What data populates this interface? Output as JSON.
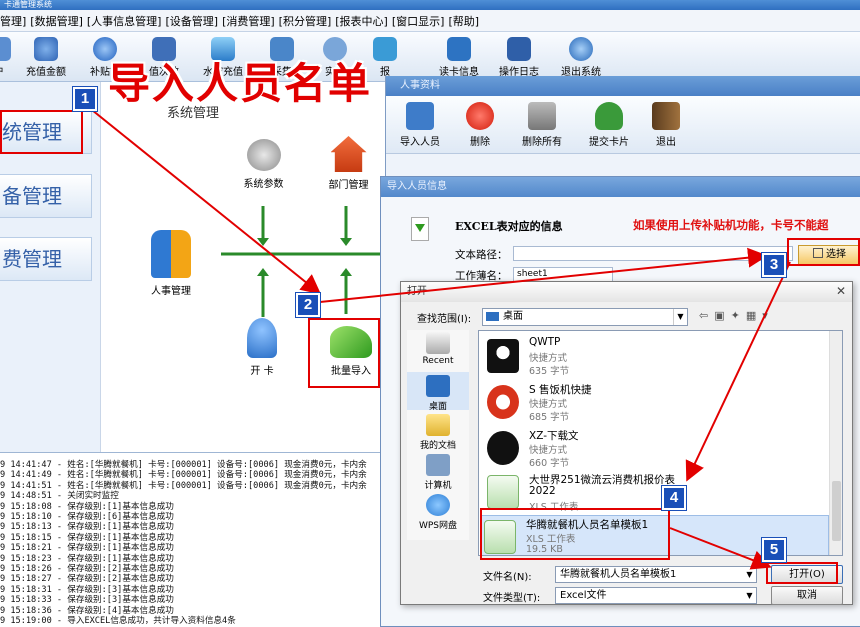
{
  "app": {
    "title": "卡通管理系统"
  },
  "menu": [
    "管理]",
    "[数据管理]",
    "[人事信息管理]",
    "[设备管理]",
    "[消费管理]",
    "[积分管理]",
    "[报表中心]",
    "[窗口显示]",
    "[帮助]"
  ],
  "toolbar": {
    "items": [
      {
        "label": "户",
        "icon": "user-icon"
      },
      {
        "label": "充值金额",
        "icon": "recharge-icon"
      },
      {
        "label": "补贴管",
        "icon": "subsidy-icon"
      },
      {
        "label": "值次数",
        "icon": "count-icon"
      },
      {
        "label": "水控充值",
        "icon": "water-icon"
      },
      {
        "label": "采集",
        "icon": "collect-icon"
      },
      {
        "label": "实时",
        "icon": "realtime-icon"
      },
      {
        "label": "报",
        "icon": "report-icon"
      },
      {
        "label": "读卡信息",
        "icon": "card-read-icon"
      },
      {
        "label": "操作日志",
        "icon": "log-icon"
      },
      {
        "label": "退出系统",
        "icon": "exit-icon"
      }
    ]
  },
  "sidebar": {
    "items": [
      "统管理",
      "备管理",
      "费管理"
    ]
  },
  "content": {
    "section_title": "系统管理",
    "nodes": {
      "system_params": "系统参数",
      "department": "部门管理",
      "personnel": "人事管理",
      "issue_card": "开 卡",
      "batch_import": "批量导入"
    }
  },
  "log": [
    "9 14:41:47 - 姓名:[华腾就餐机] 卡号:[000001] 设备号:[0006] 现金消费0元，卡内余",
    "9 14:41:49 - 姓名:[华腾就餐机] 卡号:[000001] 设备号:[0006] 现金消费0元，卡内余",
    "9 14:41:51 - 姓名:[华腾就餐机] 卡号:[000001] 设备号:[0006] 现金消费0元，卡内余",
    "9 14:48:51 - 关闭实时监控",
    "9 15:18:08 - 保存级别:[1]基本信息成功",
    "9 15:18:10 - 保存级别:[6]基本信息成功",
    "9 15:18:13 - 保存级别:[1]基本信息成功",
    "9 15:18:15 - 保存级别:[1]基本信息成功",
    "9 15:18:21 - 保存级别:[1]基本信息成功",
    "9 15:18:23 - 保存级别:[1]基本信息成功",
    "9 15:18:26 - 保存级别:[2]基本信息成功",
    "9 15:18:27 - 保存级别:[2]基本信息成功",
    "9 15:18:31 - 保存级别:[3]基本信息成功",
    "9 15:18:33 - 保存级别:[3]基本信息成功",
    "9 15:18:36 - 保存级别:[4]基本信息成功",
    "9 15:19:00 - 导入EXCEL信息成功，共计导入资料信息4条"
  ],
  "import_window": {
    "title": "人事资料",
    "buttons": [
      "导入人员",
      "删除",
      "删除所有",
      "提交卡片",
      "退出"
    ]
  },
  "excel_window": {
    "title": "导入人员信息",
    "heading": "EXCEL表对应的信息",
    "warning": "如果使用上传补贴机功能，卡号不能超",
    "path_label": "文本路径：",
    "sheet_label": "工作薄名：",
    "sheet_value": "sheet1",
    "select_button": "选择"
  },
  "open_dialog": {
    "title": "打开",
    "lookin_label": "查找范围(I):",
    "lookin_value": "桌面",
    "places": [
      "Recent",
      "桌面",
      "我的文档",
      "计算机",
      "WPS网盘"
    ],
    "files": [
      {
        "name": "QWTP",
        "type": "快捷方式",
        "size": "635 字节"
      },
      {
        "name": "S 售饭机快捷",
        "type": "快捷方式",
        "size": "685 字节"
      },
      {
        "name": "XZ-下载文",
        "type": "快捷方式",
        "size": "660 字节"
      },
      {
        "name": "大世界251微流云消费机报价表",
        "name2": "2022",
        "type": "XLS 工作表",
        "size": ""
      },
      {
        "name": "华腾就餐机人员名单模板1",
        "type": "XLS 工作表",
        "size": "19.5 KB"
      }
    ],
    "filename_label": "文件名(N):",
    "filename_value": "华腾就餐机人员名单模板1",
    "filetype_label": "文件类型(T):",
    "filetype_value": "Excel文件",
    "open_button": "打开(O)",
    "cancel_button": "取消"
  },
  "annotation": {
    "banner": "导入人员名单",
    "steps": [
      "1",
      "2",
      "3",
      "4",
      "5"
    ]
  }
}
